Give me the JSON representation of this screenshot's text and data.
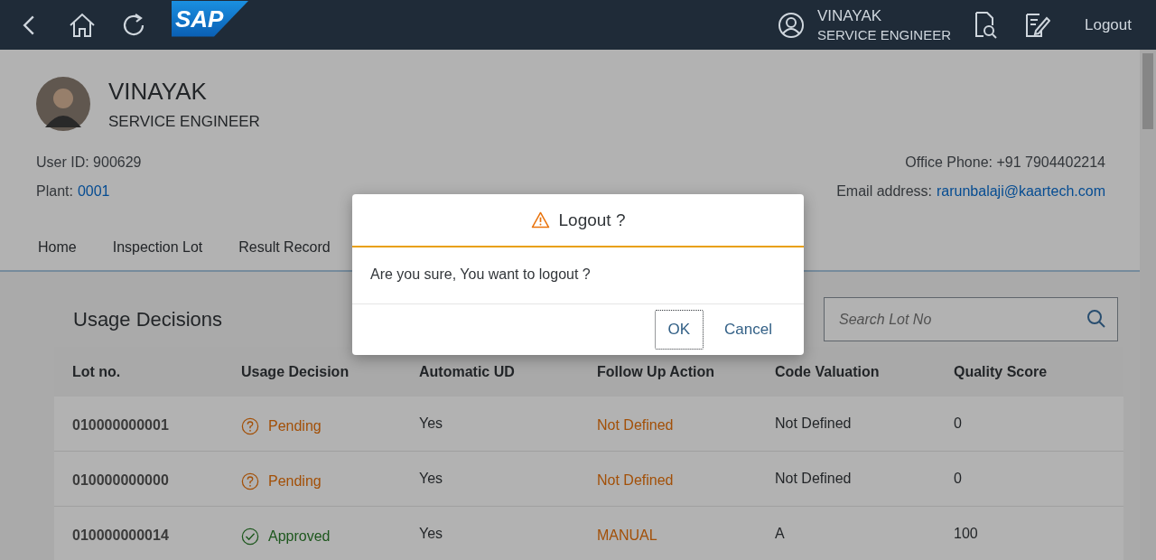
{
  "top_bar": {
    "logo": "SAP",
    "user_name": "VINAYAK",
    "user_role": "SERVICE ENGINEER",
    "logout": "Logout"
  },
  "profile": {
    "name": "VINAYAK",
    "role": "SERVICE ENGINEER",
    "user_id": "User ID: 900629",
    "plant_label": "Plant:",
    "plant": "0001",
    "phone": "Office Phone: +91 7904402214",
    "email_label": "Email address:",
    "email": "rarunbalaji@kaartech.com"
  },
  "tabs": [
    {
      "label": "Home"
    },
    {
      "label": "Inspection Lot"
    },
    {
      "label": "Result Record"
    }
  ],
  "section": {
    "title": "Usage Decisions",
    "search": {
      "placeholder": "Search Lot No"
    }
  },
  "table": {
    "columns": [
      "Lot no.",
      "Usage Decision",
      "Automatic UD",
      "Follow Up Action",
      "Code Valuation",
      "Quality Score"
    ],
    "rows": [
      {
        "lot": "010000000001",
        "decision": {
          "kind": "pending",
          "text": "Pending"
        },
        "automatic": "Yes",
        "follow_up": "Not Defined",
        "code": "Not Defined",
        "score": "0"
      },
      {
        "lot": "010000000000",
        "decision": {
          "kind": "pending",
          "text": "Pending"
        },
        "automatic": "Yes",
        "follow_up": "Not Defined",
        "code": "Not Defined",
        "score": "0"
      },
      {
        "lot": "010000000014",
        "decision": {
          "kind": "approved",
          "text": "Approved"
        },
        "automatic": "Yes",
        "follow_up": "MANUAL",
        "code": "A",
        "score": "100"
      }
    ]
  },
  "dialog": {
    "title": "Logout ?",
    "message": "Are you sure, You want to logout ?",
    "buttons": [
      {
        "label": "OK",
        "focused": true
      },
      {
        "label": "Cancel",
        "focused": false
      }
    ]
  }
}
